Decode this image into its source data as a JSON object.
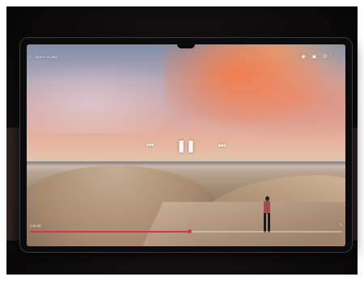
{
  "player": {
    "title": "Space to play",
    "current_time": "0:00:38",
    "progress_fraction": 0.51,
    "accent_color": "#d3374b"
  },
  "icons": {
    "back": "back-arrow-icon",
    "top_right": [
      "eye-icon",
      "picture-in-picture-icon",
      "settings-icon",
      "more-icon"
    ],
    "controls": [
      "skip-back-icon",
      "pause-icon",
      "skip-forward-icon"
    ],
    "corner": "fullscreen-icon"
  }
}
